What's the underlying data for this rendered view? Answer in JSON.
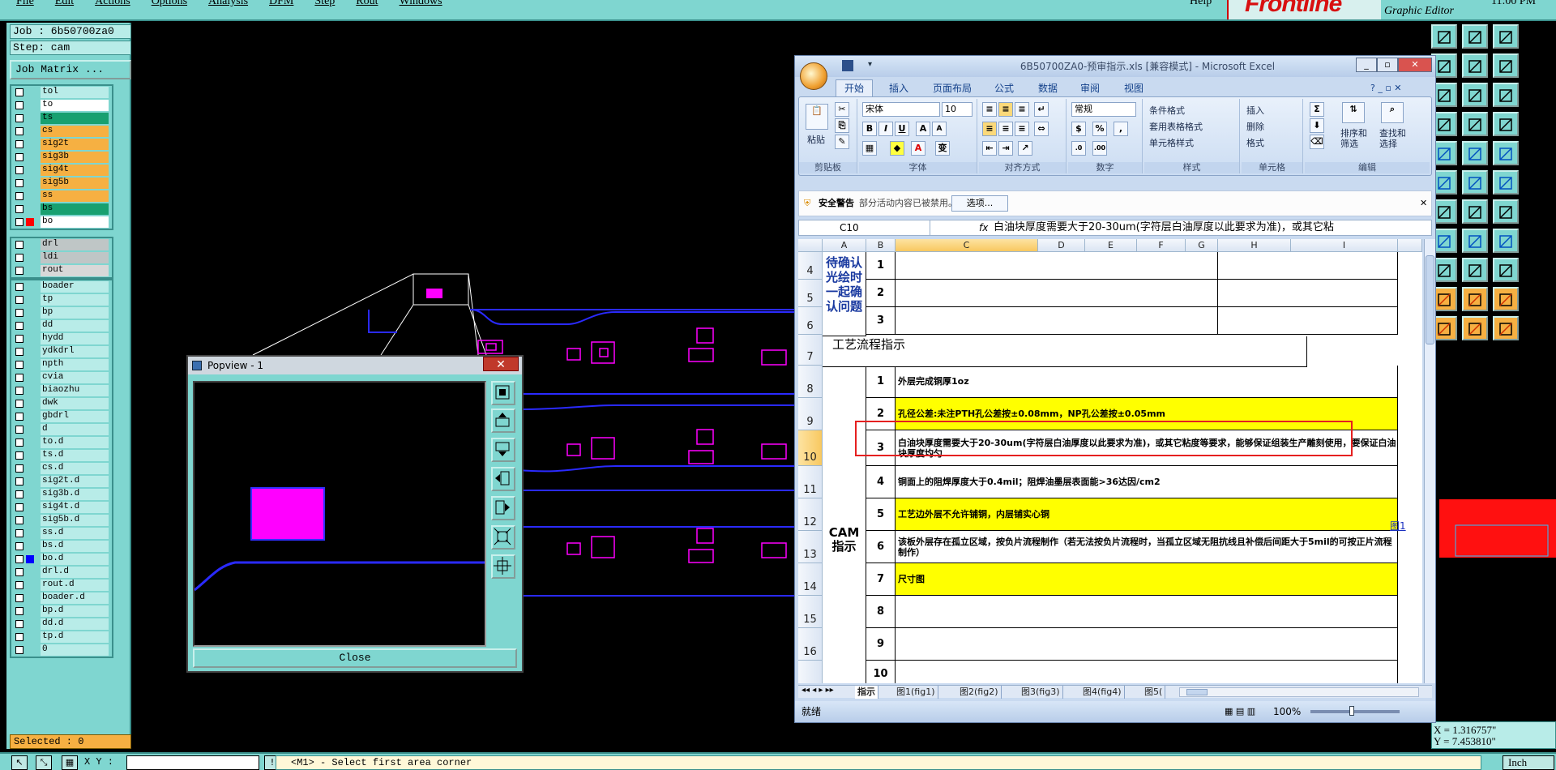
{
  "menubar": {
    "items": [
      "File",
      "Edit",
      "Actions",
      "Options",
      "Analysis",
      "DFM",
      "Step",
      "Rout",
      "Windows"
    ],
    "help": "Help",
    "logo": "Frontline",
    "subtitle": "Graphic Editor",
    "clock": "11:00 PM"
  },
  "leftpanel": {
    "job": "Job : 6b50700za0",
    "step": "Step: cam",
    "job_matrix": "Job Matrix ...",
    "groups": [
      [
        {
          "name": "tol",
          "color": null
        },
        {
          "name": "to",
          "color": null
        },
        {
          "name": "ts",
          "color": null
        },
        {
          "name": "cs",
          "color": null
        },
        {
          "name": "sig2t",
          "color": null
        },
        {
          "name": "sig3b",
          "color": null
        },
        {
          "name": "sig4t",
          "color": null
        },
        {
          "name": "sig5b",
          "color": null
        },
        {
          "name": "ss",
          "color": null
        },
        {
          "name": "bs",
          "color": null
        },
        {
          "name": "bo",
          "color": "#ff0000"
        }
      ],
      [
        {
          "name": "drl",
          "color": null
        },
        {
          "name": "ldi",
          "color": null
        },
        {
          "name": "rout",
          "color": null
        }
      ],
      [
        {
          "name": "boader",
          "color": null
        },
        {
          "name": "tp",
          "color": null
        },
        {
          "name": "bp",
          "color": null
        },
        {
          "name": "dd",
          "color": null
        },
        {
          "name": "hydd",
          "color": null
        },
        {
          "name": "ydkdrl",
          "color": null
        },
        {
          "name": "npth",
          "color": null
        },
        {
          "name": "cvia",
          "color": null
        },
        {
          "name": "biaozhu",
          "color": null
        },
        {
          "name": "dwk",
          "color": null
        },
        {
          "name": "gbdrl",
          "color": null
        },
        {
          "name": "d",
          "color": null
        },
        {
          "name": "to.d",
          "color": null
        },
        {
          "name": "ts.d",
          "color": null
        },
        {
          "name": "cs.d",
          "color": null
        },
        {
          "name": "sig2t.d",
          "color": null
        },
        {
          "name": "sig3b.d",
          "color": null
        },
        {
          "name": "sig4t.d",
          "color": null
        },
        {
          "name": "sig5b.d",
          "color": null
        },
        {
          "name": "ss.d",
          "color": null
        },
        {
          "name": "bs.d",
          "color": null
        },
        {
          "name": "bo.d",
          "color": "#0000ff"
        },
        {
          "name": "drl.d",
          "color": null
        },
        {
          "name": "rout.d",
          "color": null
        },
        {
          "name": "boader.d",
          "color": null
        },
        {
          "name": "bp.d",
          "color": null
        },
        {
          "name": "dd.d",
          "color": null
        },
        {
          "name": "tp.d",
          "color": null
        },
        {
          "name": "0",
          "color": null
        }
      ]
    ],
    "selected": "Selected : 0"
  },
  "bottombar": {
    "xy_label": "X Y :",
    "status": "<M1> - Select first area corner",
    "units": "Inch"
  },
  "coords": {
    "x": "X = 1.316757\"",
    "y": "Y = 7.453810\""
  },
  "popview": {
    "title": "Popview - 1",
    "close": "Close"
  },
  "excel": {
    "title": "6B50700ZA0-预审指示.xls  [兼容模式]  -  Microsoft Excel",
    "tabs": [
      "开始",
      "插入",
      "页面布局",
      "公式",
      "数据",
      "审阅",
      "视图"
    ],
    "ribbon": {
      "paste": "粘贴",
      "clipboard": "剪贴板",
      "font_name": "宋体",
      "font_size": "10",
      "font_group": "字体",
      "align_group": "对齐方式",
      "number_format": "常规",
      "number_group": "数字",
      "cond_format": "条件格式",
      "table_format": "套用表格格式",
      "cell_style": "单元格样式",
      "style_group": "样式",
      "insert": "插入",
      "delete": "删除",
      "format": "格式",
      "cells_group": "单元格",
      "sort_filter": "排序和\n筛选",
      "find_select": "查找和\n选择",
      "edit_group": "编辑",
      "bold": "B",
      "italic": "I",
      "underline": "U"
    },
    "security": {
      "title": "安全警告",
      "message": "部分活动内容已被禁用。",
      "options": "选项..."
    },
    "formula": {
      "namebox": "C10",
      "fx": "fx",
      "value": "白油块厚度需要大于20-30um(字符层白油厚度以此要求为准)，或其它粘"
    },
    "columns": [
      "A",
      "B",
      "C",
      "D",
      "E",
      "F",
      "G",
      "H",
      "I"
    ],
    "rows": [
      {
        "n": "4",
        "b": "1",
        "c": "",
        "yellow": false
      },
      {
        "n": "5",
        "b": "2",
        "c": "",
        "yellow": false
      },
      {
        "n": "6",
        "b": "3",
        "c": "",
        "yellow": false
      },
      {
        "n": "7",
        "b": "",
        "c": "",
        "yellow": false
      },
      {
        "n": "8",
        "b": "1",
        "c": "外层完成铜厚1oz",
        "yellow": false
      },
      {
        "n": "9",
        "b": "2",
        "c": "孔径公差:未注PTH孔公差按±0.08mm，NP孔公差按±0.05mm",
        "yellow": true
      },
      {
        "n": "10",
        "b": "3",
        "c": "白油块厚度需要大于20-30um(字符层白油厚度以此要求为准)，或其它粘度等要求，能够保证组装生产雕刻使用，要保证白油块厚度均匀",
        "yellow": false
      },
      {
        "n": "11",
        "b": "4",
        "c": "铜面上的阻焊厚度大于0.4mil；阻焊油墨层表面能>36达因/cm2",
        "yellow": false
      },
      {
        "n": "12",
        "b": "5",
        "c": "工艺边外层不允许铺铜，内层铺实心铜",
        "yellow": true
      },
      {
        "n": "13",
        "b": "6",
        "c": "该板外层存在孤立区域，按负片流程制作（若无法按负片流程时，当孤立区域无阻抗线且补偿后间距大于5mil的可按正片流程制作）",
        "yellow": false
      },
      {
        "n": "14",
        "b": "7",
        "c": "尺寸图",
        "yellow": true
      },
      {
        "n": "15",
        "b": "8",
        "c": "",
        "yellow": false
      },
      {
        "n": "16",
        "b": "9",
        "c": "",
        "yellow": false
      },
      {
        "n": "",
        "b": "10",
        "c": "",
        "yellow": false
      }
    ],
    "cat_confirm": "待确认光绘时一起确认问题",
    "cat_flow": "工艺流程指示",
    "cat_cam": "CAM\n指示",
    "fig_link": "图1",
    "sheets": [
      "指示",
      "图1(fig1)",
      "图2(fig2)",
      "图3(fig3)",
      "图4(fig4)",
      "图5("
    ],
    "status": "就绪",
    "zoom": "100%"
  }
}
